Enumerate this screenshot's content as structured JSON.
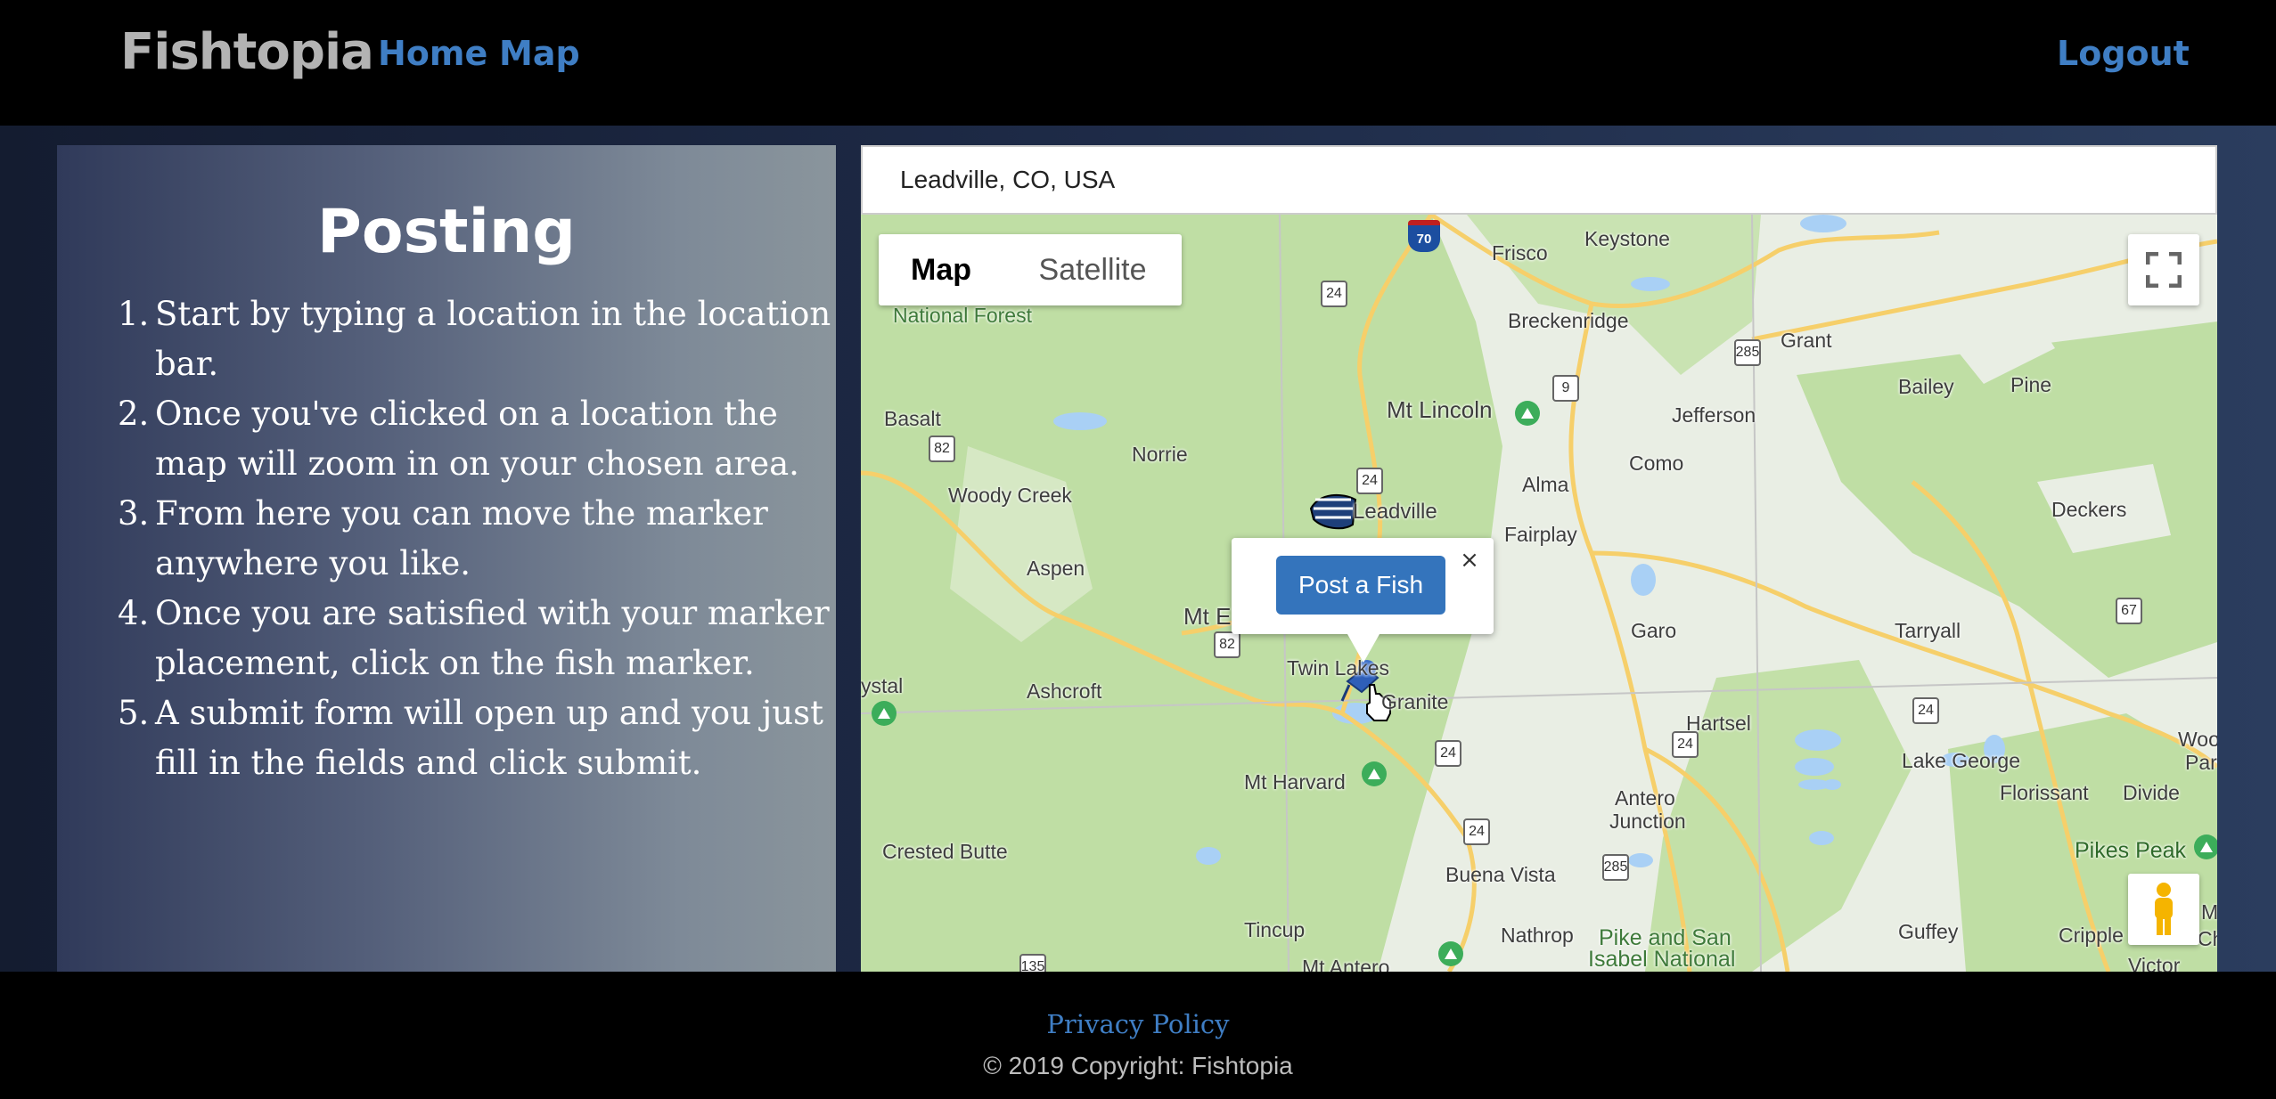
{
  "navbar": {
    "brand": "Fishtopia",
    "links": [
      {
        "label": "Home"
      },
      {
        "label": "Map"
      }
    ],
    "logout_label": "Logout"
  },
  "info_panel": {
    "title": "Posting",
    "steps": [
      "Start by typing a location in the location bar.",
      "Once you've clicked on a location the map will zoom in on your chosen area.",
      "From here you can move the marker anywhere you like.",
      "Once you are satisfied with your marker placement, click on the fish marker.",
      "A submit form will open up and you just fill in the fields and click submit."
    ]
  },
  "map": {
    "location_value": "Leadville, CO, USA",
    "map_type_options": [
      "Map",
      "Satellite"
    ],
    "selected_map_type": "Map",
    "info_window": {
      "button_label": "Post a Fish",
      "close_glyph": "×"
    },
    "places": [
      "Frisco",
      "Keystone",
      "Breckenridge",
      "Grant",
      "Bailey",
      "Pine",
      "National Forest",
      "Basalt",
      "Norrie",
      "Mt Lincoln",
      "Jefferson",
      "Woody Creek",
      "Leadville",
      "Alma",
      "Como",
      "Deckers",
      "Aspen",
      "Fairplay",
      "Mt E",
      "Garo",
      "Tarryall",
      "ystal",
      "Ashcroft",
      "Twin Lakes",
      "Granite",
      "Hartsel",
      "Lake George",
      "Woodla",
      "Park",
      "Florissant",
      "Divide",
      "Mt Harvard",
      "Antero",
      "Junction",
      "Crested Butte",
      "Buena Vista",
      "Pikes Peak",
      "Tincup",
      "Nathrop",
      "Pike and San",
      "Isabel National",
      "Guffey",
      "Cripple Creek",
      "Victor",
      "Mt Antero",
      "Ch",
      "M"
    ],
    "route_shields": [
      "70",
      "24",
      "285",
      "9",
      "82",
      "24",
      "82",
      "24",
      "24",
      "24",
      "67",
      "285",
      "135",
      "24"
    ],
    "colors": {
      "land": "#e9eee4",
      "forest": "#bfdea4",
      "road": "#f6cf6a",
      "water": "#a9d0f5",
      "marker": "#2f5fb8"
    }
  },
  "footer": {
    "privacy_label": "Privacy Policy",
    "copyright": "© 2019 Copyright: Fishtopia"
  }
}
